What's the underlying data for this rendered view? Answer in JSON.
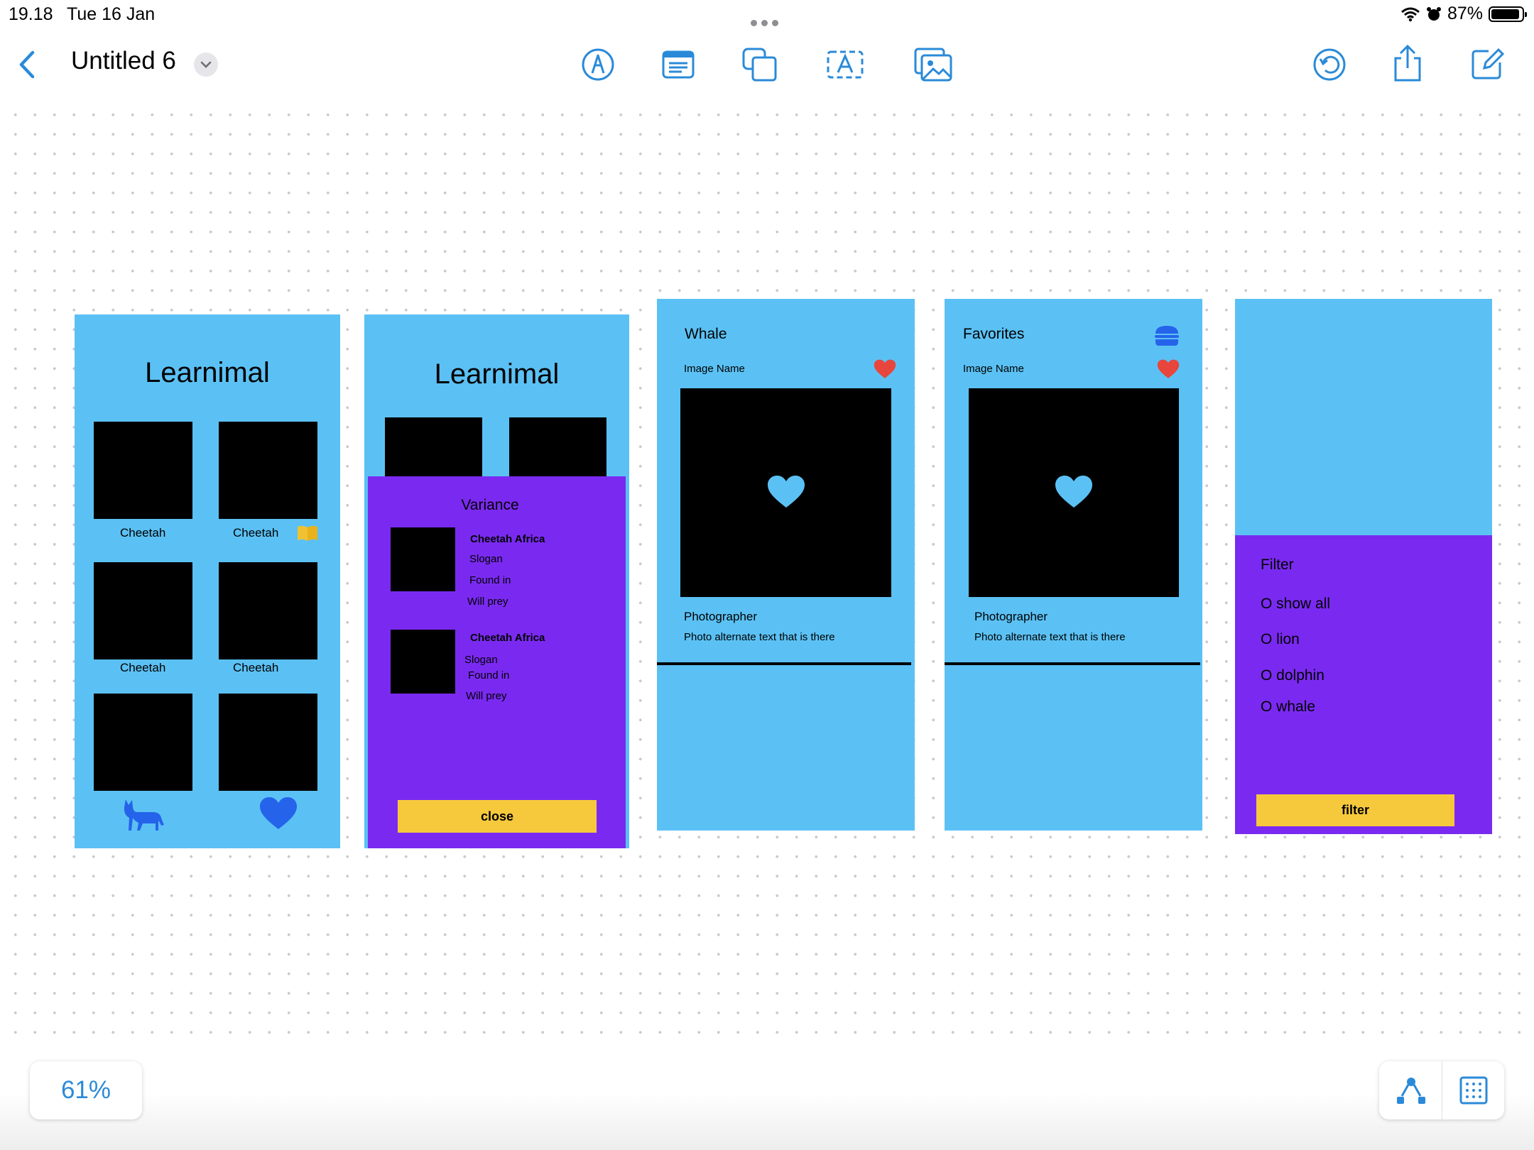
{
  "status_bar": {
    "time": "19.18",
    "date": "Tue 16 Jan",
    "battery": "87%"
  },
  "toolbar": {
    "title": "Untitled 6",
    "tools": [
      "pen-tool-icon",
      "text-box-icon",
      "shapes-icon",
      "text-icon",
      "media-icon"
    ],
    "right_actions": [
      "undo-icon",
      "share-icon",
      "compose-icon"
    ]
  },
  "screens": {
    "home": {
      "title": "Learnimal",
      "tiles": [
        "Cheetah",
        "Cheetah",
        "Cheetah",
        "Cheetah"
      ],
      "nav_icons": [
        "cat-icon",
        "heart-icon"
      ]
    },
    "variance": {
      "bg_title": "Learnimal",
      "title": "Variance",
      "items": [
        {
          "name": "Cheetah Africa",
          "slogan": "Slogan",
          "found": "Found in",
          "prey": "Will prey"
        },
        {
          "name": "Cheetah Africa",
          "slogan": "Slogan",
          "found": "Found in",
          "prey": "Will prey"
        }
      ],
      "close_label": "close"
    },
    "detail": {
      "title": "Whale",
      "image_name": "Image Name",
      "photographer": "Photographer",
      "alt_text": "Photo alternate text that is there"
    },
    "favorites": {
      "title": "Favorites",
      "image_name": "Image Name",
      "photographer": "Photographer",
      "alt_text": "Photo alternate text that is there"
    },
    "filter": {
      "title": "Filter",
      "options": [
        "O show all",
        "O lion",
        "O dolphin",
        "O whale"
      ],
      "button_label": "filter"
    }
  },
  "zoom": "61%",
  "colors": {
    "screen_blue": "#5bc1f4",
    "panel_purple": "#7a2af0",
    "button_yellow": "#f6c93d",
    "accent": "#2a8ad8",
    "heart_red": "#e8453c"
  }
}
